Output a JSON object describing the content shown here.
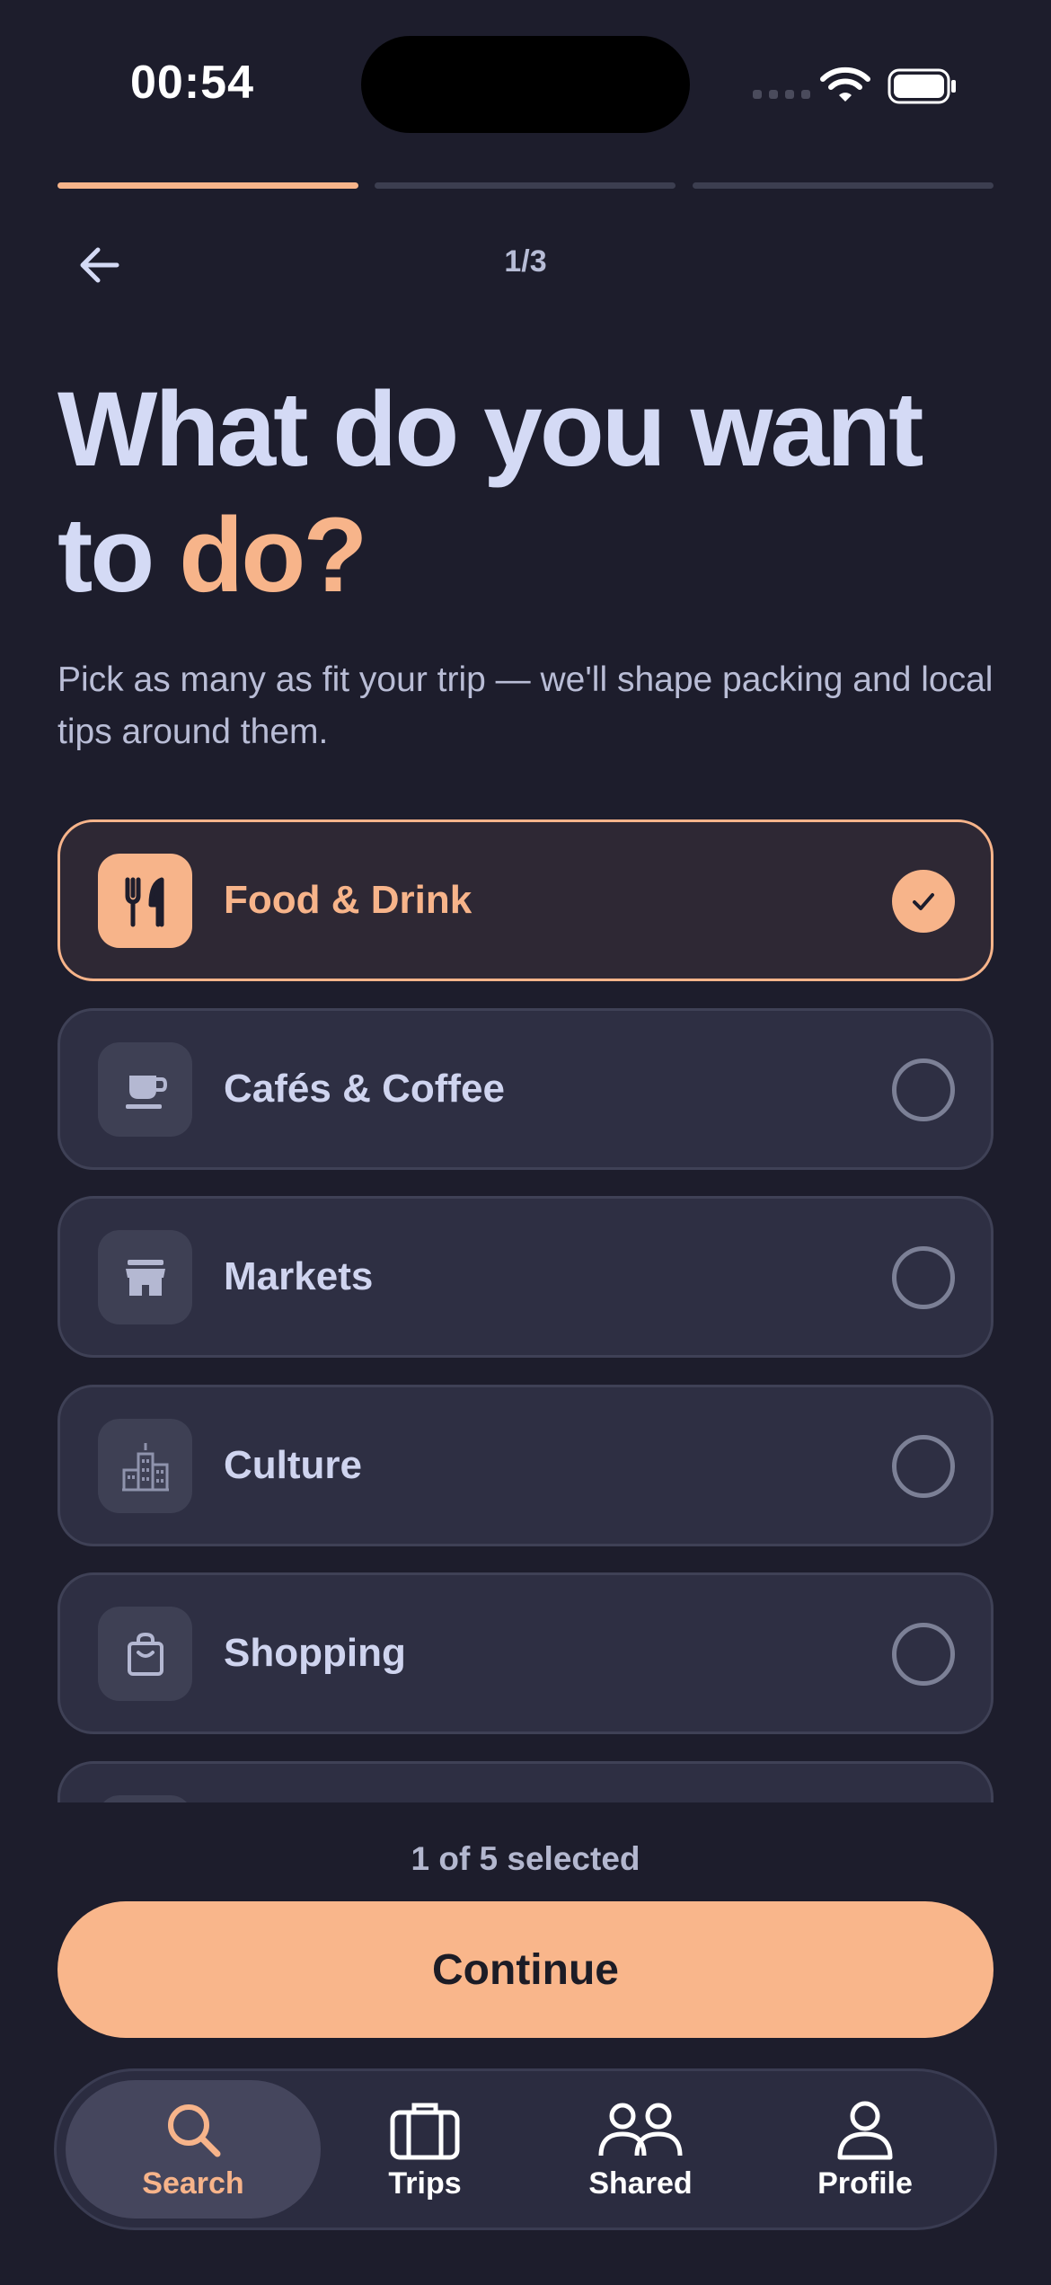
{
  "status_bar": {
    "time": "00:54"
  },
  "header": {
    "step": "1/3",
    "progress_steps_total": 3,
    "progress_current": 1
  },
  "title": {
    "line1": "What do you want",
    "line2_plain": "to ",
    "line2_accent": "do?"
  },
  "subtitle": "Pick as many as fit your trip — we'll shape packing and local tips around them.",
  "options": [
    {
      "label": "Food & Drink",
      "icon": "utensils-icon",
      "selected": true
    },
    {
      "label": "Cafés & Coffee",
      "icon": "coffee-cup-icon",
      "selected": false
    },
    {
      "label": "Markets",
      "icon": "storefront-icon",
      "selected": false
    },
    {
      "label": "Culture",
      "icon": "city-buildings-icon",
      "selected": false
    },
    {
      "label": "Shopping",
      "icon": "shopping-bag-icon",
      "selected": false
    }
  ],
  "footer": {
    "selection_count": "1 of 5 selected",
    "continue_label": "Continue"
  },
  "tabbar": {
    "items": [
      {
        "label": "Search",
        "icon": "search-icon",
        "active": true
      },
      {
        "label": "Trips",
        "icon": "suitcase-icon",
        "active": false
      },
      {
        "label": "Shared",
        "icon": "people-icon",
        "active": false
      },
      {
        "label": "Profile",
        "icon": "person-icon",
        "active": false
      }
    ]
  },
  "colors": {
    "background": "#1d1d2c",
    "accent": "#f7b48a",
    "card": "#2e2f43",
    "text": "#d4daf5"
  }
}
